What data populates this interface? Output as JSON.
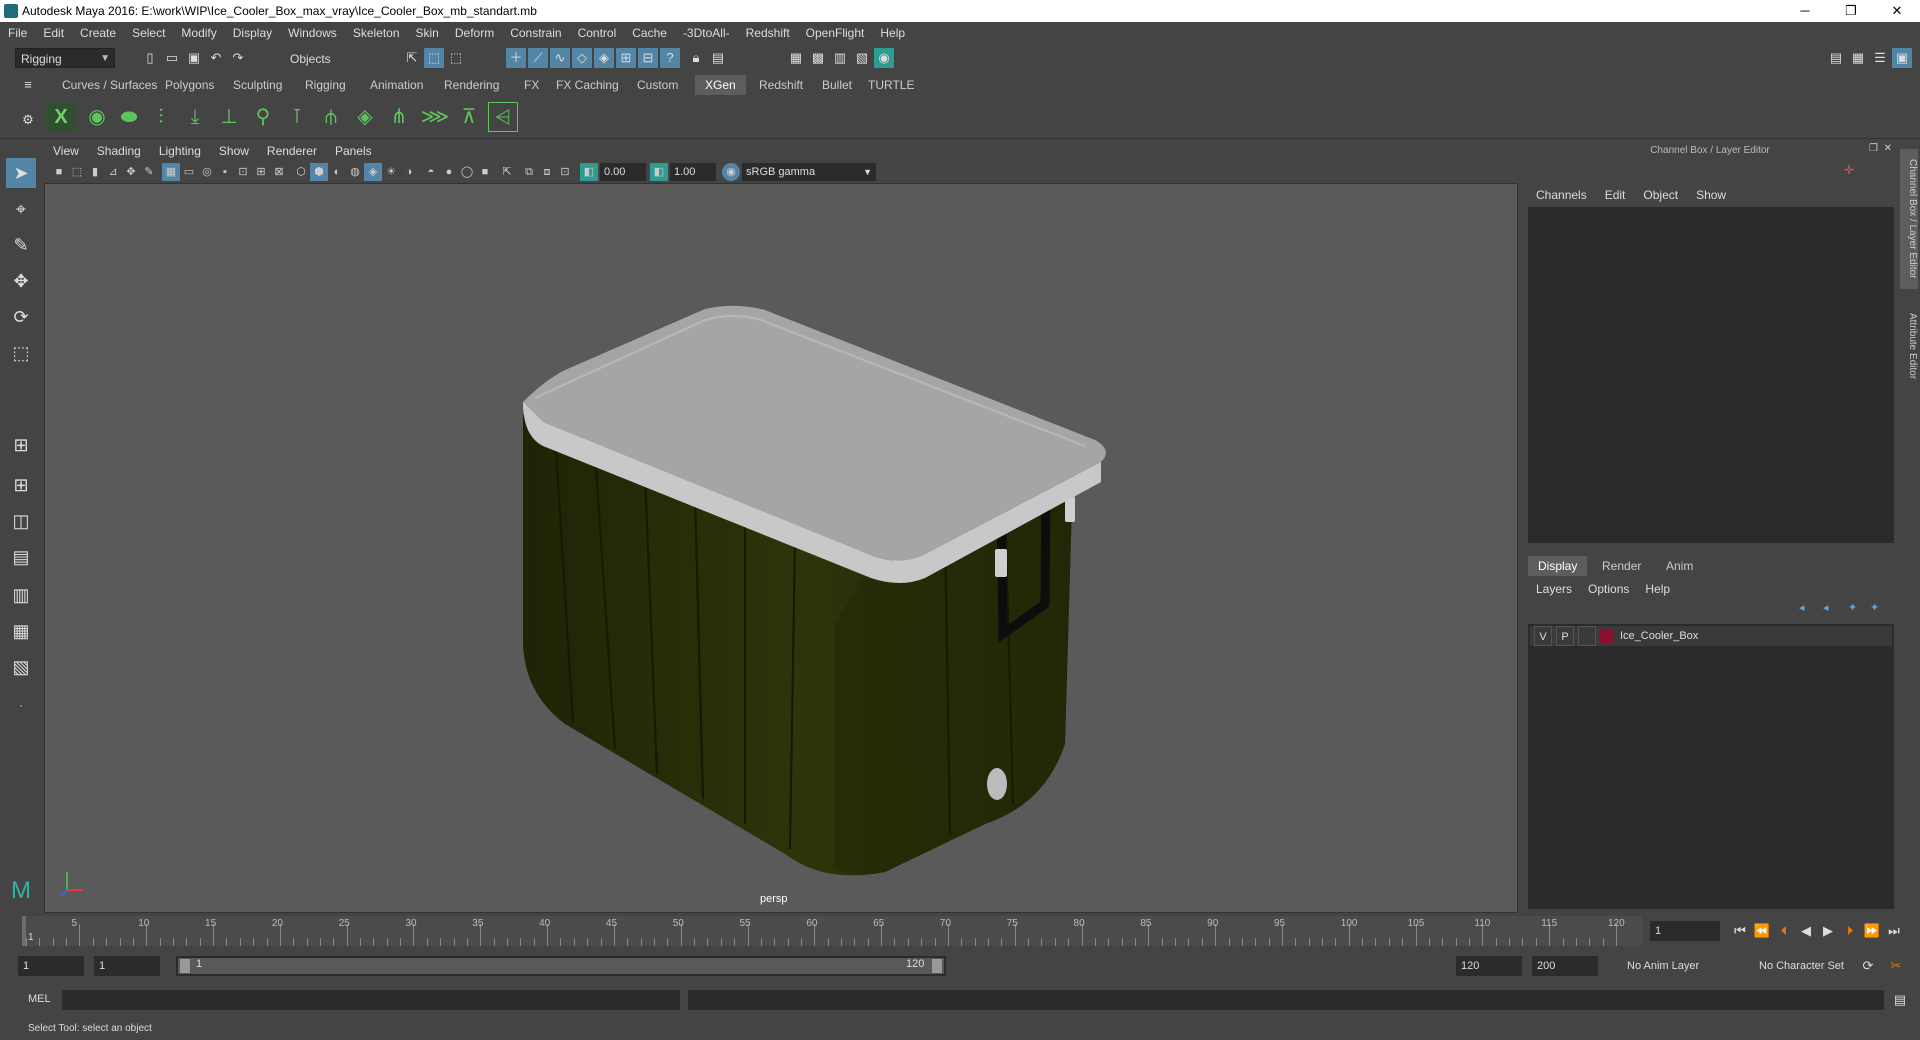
{
  "window": {
    "title": "Autodesk Maya 2016: E:\\work\\WIP\\Ice_Cooler_Box_max_vray\\Ice_Cooler_Box_mb_standart.mb",
    "minimize": "─",
    "restore": "❐",
    "close": "✕"
  },
  "menubar": [
    "File",
    "Edit",
    "Create",
    "Select",
    "Modify",
    "Display",
    "Windows",
    "Skeleton",
    "Skin",
    "Deform",
    "Constrain",
    "Control",
    "Cache",
    "-3DtoAll-",
    "Redshift",
    "OpenFlight",
    "Help"
  ],
  "statusline": {
    "mode": "Rigging",
    "selection_mask": "Objects"
  },
  "shelf": {
    "tabs": [
      "Curves / Surfaces",
      "Polygons",
      "Sculpting",
      "Rigging",
      "Animation",
      "Rendering",
      "FX",
      "FX Caching",
      "Custom",
      "XGen",
      "Redshift",
      "Bullet",
      "TURTLE"
    ],
    "active": "XGen"
  },
  "viewport": {
    "menu": [
      "View",
      "Shading",
      "Lighting",
      "Show",
      "Renderer",
      "Panels"
    ],
    "exposure": "0.00",
    "gamma": "1.00",
    "colorspace": "sRGB gamma",
    "camera": "persp"
  },
  "channelbox": {
    "header": "Channel Box / Layer Editor",
    "menu": [
      "Channels",
      "Edit",
      "Object",
      "Show"
    ]
  },
  "layereditor": {
    "tabs": [
      "Display",
      "Render",
      "Anim"
    ],
    "active": "Display",
    "menu": [
      "Layers",
      "Options",
      "Help"
    ],
    "layers": [
      {
        "v": "V",
        "p": "P",
        "name": "Ice_Cooler_Box",
        "color": "#8b1030"
      }
    ]
  },
  "sidetabs": [
    "Channel Box / Layer Editor",
    "Attribute Editor"
  ],
  "timeline": {
    "ticks": [
      "5",
      "10",
      "15",
      "20",
      "25",
      "30",
      "35",
      "40",
      "45",
      "50",
      "55",
      "60",
      "65",
      "70",
      "75",
      "80",
      "85",
      "90",
      "95",
      "100",
      "105",
      "110",
      "115",
      "120"
    ],
    "start_label": "1",
    "current_frame": "1"
  },
  "range": {
    "start": "1",
    "anim_start": "1",
    "slider_start": "1",
    "slider_end": "120",
    "playback_end": "120",
    "anim_end": "200",
    "anim_layer": "No Anim Layer",
    "char_set": "No Character Set"
  },
  "commandline": {
    "label": "MEL"
  },
  "helpline": "Select Tool: select an object",
  "colors": {
    "accent": "#5285a6",
    "shelf_green": "#5ec45e",
    "cooler_body": "#2c3309",
    "cooler_lid": "#a5a5a5"
  }
}
